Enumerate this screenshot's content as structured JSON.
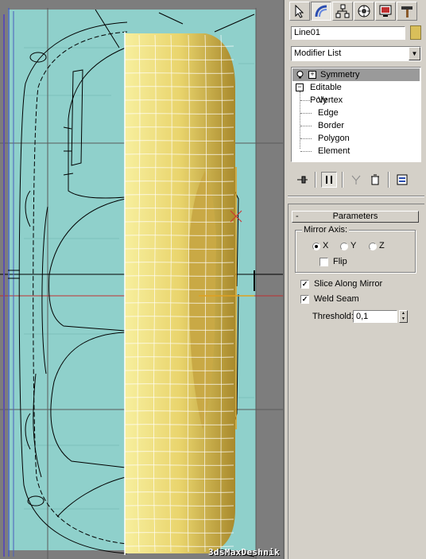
{
  "viewport": {
    "watermark": "3dsMaxDeshnik",
    "colors": {
      "background": "#7d7d7d",
      "blueprint": "#8fd0cb",
      "mesh": "#e7d36a",
      "wire": "#ffffff",
      "lines": "#000000"
    }
  },
  "command_panel": {
    "tabs": [
      {
        "icon": "create-arrow-icon",
        "active": false
      },
      {
        "icon": "modify-icon",
        "active": true
      },
      {
        "icon": "hierarchy-icon",
        "active": false
      },
      {
        "icon": "motion-icon",
        "active": false
      },
      {
        "icon": "display-icon",
        "active": false
      },
      {
        "icon": "utilities-hammer-icon",
        "active": false
      }
    ],
    "object_name": "Line01",
    "object_color": "#d9bf5a",
    "modifier_list": "Modifier List",
    "stack": {
      "symmetry": "Symmetry",
      "editable_poly": "Editable Poly",
      "subobjects": [
        "Vertex",
        "Edge",
        "Border",
        "Polygon",
        "Element"
      ]
    },
    "rollout": {
      "title": "Parameters",
      "collapse": "-",
      "mirror_axis_label": "Mirror Axis:",
      "axes": [
        "X",
        "Y",
        "Z"
      ],
      "selected_axis": "X",
      "flip_label": "Flip",
      "flip_checked": false,
      "slice_label": "Slice Along Mirror",
      "slice_checked": true,
      "weld_label": "Weld Seam",
      "weld_checked": true,
      "threshold_label": "Threshold:",
      "threshold_value": "0,1"
    }
  }
}
